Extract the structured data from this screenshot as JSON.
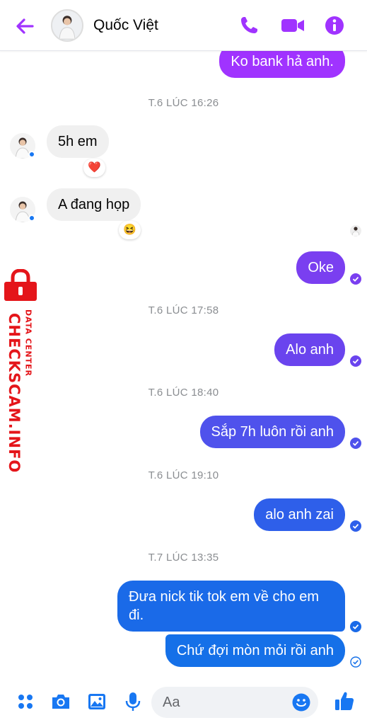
{
  "header": {
    "contact_name": "Quốc Việt",
    "accent_color": "#a033ff",
    "icons": [
      "back-arrow-icon",
      "phone-icon",
      "video-call-icon",
      "info-icon"
    ]
  },
  "messages": [
    {
      "type": "out",
      "text": "Ko bank hả anh.",
      "color": "#a033ff"
    },
    {
      "type": "timestamp",
      "text": "T.6 LÚC 16:26"
    },
    {
      "type": "in",
      "text": "5h em",
      "reaction": "❤️"
    },
    {
      "type": "in",
      "text": "A đang họp",
      "reaction": "😆"
    },
    {
      "type": "out",
      "text": "Oke",
      "color": "#7a3ff0",
      "status": "seen"
    },
    {
      "type": "timestamp",
      "text": "T.6 LÚC 17:58"
    },
    {
      "type": "out",
      "text": "Alo anh",
      "color": "#6a44ee",
      "status": "seen"
    },
    {
      "type": "timestamp",
      "text": "T.6 LÚC 18:40"
    },
    {
      "type": "out",
      "text": "Sắp 7h luôn rồi anh",
      "color": "#4f52ec",
      "status": "seen"
    },
    {
      "type": "timestamp",
      "text": "T.6 LÚC 19:10"
    },
    {
      "type": "out",
      "text": "alo anh zai",
      "color": "#2e5fea",
      "status": "seen"
    },
    {
      "type": "timestamp",
      "text": "T.7 LÚC 13:35"
    },
    {
      "type": "out",
      "text": "Đưa nick tik tok em về cho em\nđi.",
      "color": "#1a6ae8",
      "status": "seen"
    },
    {
      "type": "out",
      "text": "Chứ đợi mòn mỏi rồi anh",
      "color": "#1570e8",
      "status": "sent"
    }
  ],
  "composer": {
    "placeholder": "Aa",
    "icons": [
      "menu-dots-icon",
      "camera-icon",
      "gallery-icon",
      "microphone-icon",
      "emoji-icon",
      "like-icon"
    ],
    "accent_color": "#1877f2"
  },
  "watermark": {
    "brand": "CHECKSCAM.INFO",
    "tag": "DATA CENTER",
    "color": "#e4151a"
  }
}
